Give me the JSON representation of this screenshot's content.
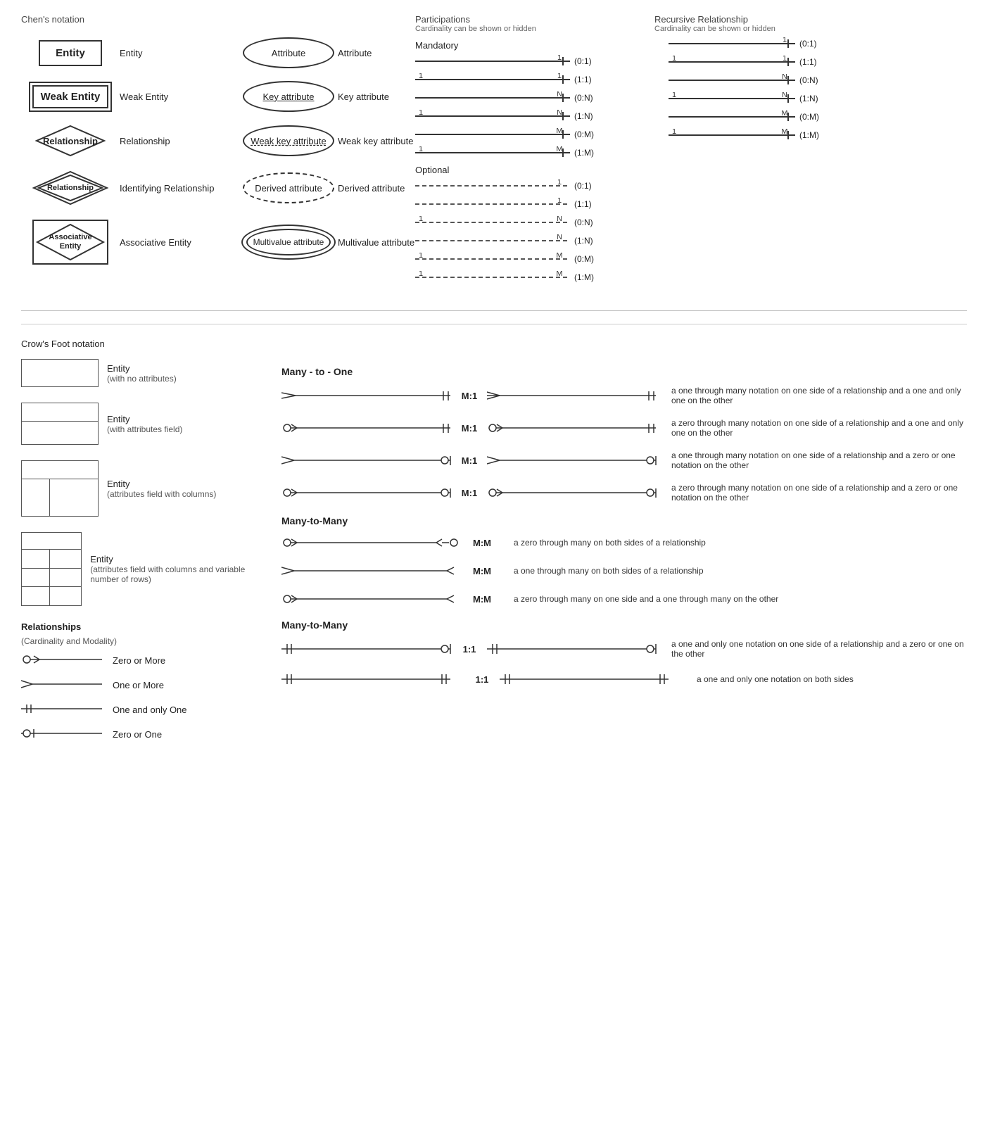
{
  "chen": {
    "title": "Chen's notation",
    "rows": [
      {
        "symbol_type": "entity",
        "symbol_label": "Entity",
        "attr_type": "ellipse",
        "attr_label": "Attribute",
        "attr_text": "Attribute",
        "row_label": "Entity",
        "attr_row_label": "Attribute"
      },
      {
        "symbol_type": "weak_entity",
        "symbol_label": "Weak Entity",
        "attr_type": "ellipse_key",
        "attr_label": "Key attribute",
        "attr_text": "Key attribute",
        "row_label": "Weak Entity",
        "attr_row_label": "Key attribute"
      },
      {
        "symbol_type": "diamond",
        "symbol_label": "Relationship",
        "attr_type": "ellipse_weakkey",
        "attr_label": "Weak key attribute",
        "attr_text": "Weak key attribute",
        "row_label": "Relationship",
        "attr_row_label": "Weak key attribute"
      },
      {
        "symbol_type": "double_diamond",
        "symbol_label": "Identifying Relationship",
        "attr_type": "ellipse_derived",
        "attr_label": "Derived attribute",
        "attr_text": "Derived attribute",
        "row_label": "Identifying Relationship",
        "attr_row_label": "Derived attribute"
      },
      {
        "symbol_type": "assoc_entity",
        "symbol_label": "Associative Entity",
        "attr_type": "ellipse_multi",
        "attr_label": "Multivalue attribute",
        "attr_text": "Multivalue attribute",
        "row_label": "Associative Entity",
        "attr_row_label": "Multivalue attribute"
      }
    ]
  },
  "participations": {
    "title": "Participations",
    "subtitle": "Cardinality can be shown or hidden",
    "mandatory_title": "Mandatory",
    "optional_title": "Optional",
    "mandatory_rows": [
      {
        "left": "",
        "right": "1",
        "cardinality": "(0:1)"
      },
      {
        "left": "1",
        "right": "1",
        "cardinality": "(1:1)"
      },
      {
        "left": "",
        "right": "N",
        "cardinality": "(0:N)"
      },
      {
        "left": "1",
        "right": "N",
        "cardinality": "(1:N)"
      },
      {
        "left": "",
        "right": "M",
        "cardinality": "(0:M)"
      },
      {
        "left": "1",
        "right": "M",
        "cardinality": "(1:M)"
      }
    ],
    "optional_rows": [
      {
        "left": "",
        "right": "1",
        "cardinality": "(0:1)"
      },
      {
        "left": "",
        "right": "1",
        "cardinality": "(1:1)"
      },
      {
        "left": "1",
        "right": "N",
        "cardinality": "(0:N)"
      },
      {
        "left": "",
        "right": "N",
        "cardinality": "(1:N)"
      },
      {
        "left": "1",
        "right": "M",
        "cardinality": "(0:M)"
      },
      {
        "left": "1",
        "right": "M",
        "cardinality": "(1:M)"
      }
    ]
  },
  "recursive": {
    "title": "Recursive Relationship",
    "subtitle": "Cardinality can be shown or hidden",
    "rows": [
      {
        "left": "",
        "right": "1",
        "cardinality": "(0:1)"
      },
      {
        "left": "1",
        "right": "1",
        "cardinality": "(1:1)"
      },
      {
        "left": "",
        "right": "N",
        "cardinality": "(0:N)"
      },
      {
        "left": "1",
        "right": "N",
        "cardinality": "(1:N)"
      },
      {
        "left": "",
        "right": "M",
        "cardinality": "(0:M)"
      },
      {
        "left": "1",
        "right": "M",
        "cardinality": "(1:M)"
      }
    ]
  },
  "crows": {
    "title": "Crow's Foot notation",
    "entities": [
      {
        "type": "simple",
        "label": "Entity",
        "sublabel": "(with no attributes)"
      },
      {
        "type": "attr",
        "label": "Entity",
        "sublabel": "(with attributes field)"
      },
      {
        "type": "col",
        "label": "Entity",
        "sublabel": "(attributes field with columns)"
      },
      {
        "type": "rows",
        "label": "Entity",
        "sublabel": "(attributes field with columns and variable number of rows)"
      }
    ],
    "relationships_title": "Relationships",
    "relationships_sub": "(Cardinality and Modality)",
    "legend": [
      {
        "sym": "zero_or_more",
        "label": "Zero or More"
      },
      {
        "sym": "one_or_more",
        "label": "One or More"
      },
      {
        "sym": "one_and_only_one",
        "label": "One and only One"
      },
      {
        "sym": "zero_or_one",
        "label": "Zero or One"
      }
    ],
    "many_to_one_title": "Many - to - One",
    "many_to_one_rows": [
      {
        "label": "M:1",
        "desc": "a one through many notation on one side of a relationship and a one and only one on the other"
      },
      {
        "label": "M:1",
        "desc": "a zero through many notation on one side of a relationship and a one and only one on the other"
      },
      {
        "label": "M:1",
        "desc": "a one through many notation on one side of a relationship and a zero or one notation on the other"
      },
      {
        "label": "M:1",
        "desc": "a zero through many notation on one side of a relationship and a zero or one notation on the other"
      }
    ],
    "many_to_many_title": "Many-to-Many",
    "many_to_many_rows": [
      {
        "label": "M:M",
        "desc": "a zero through many on both sides of a relationship"
      },
      {
        "label": "M:M",
        "desc": "a one through many on both sides of a relationship"
      },
      {
        "label": "M:M",
        "desc": "a zero through many on one side and a one through many on the other"
      }
    ],
    "many_to_many2_title": "Many-to-Many",
    "one_to_one_rows": [
      {
        "label": "1:1",
        "desc": "a one and only one notation on one side of a relationship and a zero or one on the other"
      },
      {
        "label": "1:1",
        "desc": "a one and only one notation on both sides"
      }
    ]
  }
}
